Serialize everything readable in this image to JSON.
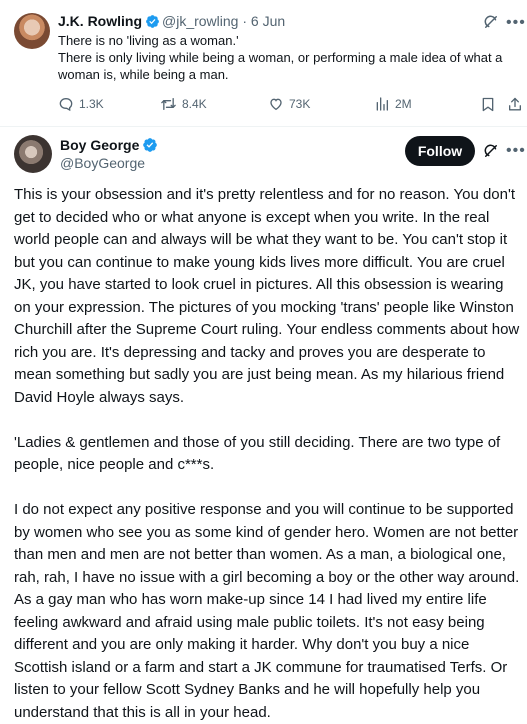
{
  "quoted_tweet": {
    "author_name": "J.K. Rowling",
    "handle": "@jk_rowling",
    "separator": "·",
    "date": "6 Jun",
    "text_lines": [
      "There is no 'living as a woman.'",
      "There is only living while being a woman, or performing a male idea of what a woman is, while being a man."
    ],
    "stats": {
      "replies": "1.3K",
      "retweets": "8.4K",
      "likes": "73K",
      "views": "2M"
    }
  },
  "reply_tweet": {
    "author_name": "Boy George",
    "handle": "@BoyGeorge",
    "follow_label": "Follow",
    "paragraphs": [
      "This is your obsession and it's pretty relentless and for no reason. You don't get to decided who or what anyone is except when you write. In the real world people can and always will be what they want to be. You can't stop it but you can continue to make young kids lives more difficult. You are cruel JK, you have started to look cruel in pictures. All this obsession is wearing on your expression. The pictures of you mocking 'trans' people like Winston Churchill after the Supreme Court ruling. Your endless comments about how rich you are. It's depressing and tacky and proves you are desperate to mean something but sadly you are just being mean. As my hilarious friend David Hoyle always says.",
      "'Ladies & gentlemen and those of you still deciding. There are two type of people, nice people and c***s.",
      "I do not expect any positive response and you will continue to be supported by women who see you as some kind of gender hero. Women are not better than men and men are not better than women. As a man, a biological one, rah, rah, I have no issue with a  girl becoming a boy or the other way around. As a gay man who has worn make-up since 14 I had lived my entire life feeling awkward and afraid using male public toilets. It's not easy being different and you are only making it harder. Why don't you buy a nice Scottish island or a farm and start a JK commune for traumatised Terfs. Or listen to your fellow Scott Sydney Banks and he will hopefully help you understand that this is all in your head."
    ]
  },
  "icons": {
    "verified": "verified-badge-icon",
    "grok": "grok-icon",
    "more": "more-icon",
    "reply": "reply-icon",
    "retweet": "retweet-icon",
    "like": "like-icon",
    "views": "views-icon",
    "bookmark": "bookmark-icon",
    "share": "share-icon"
  },
  "colors": {
    "verified": "#1d9bf0",
    "text": "#0f1419",
    "secondary": "#536471",
    "follow_bg": "#0f1419"
  }
}
